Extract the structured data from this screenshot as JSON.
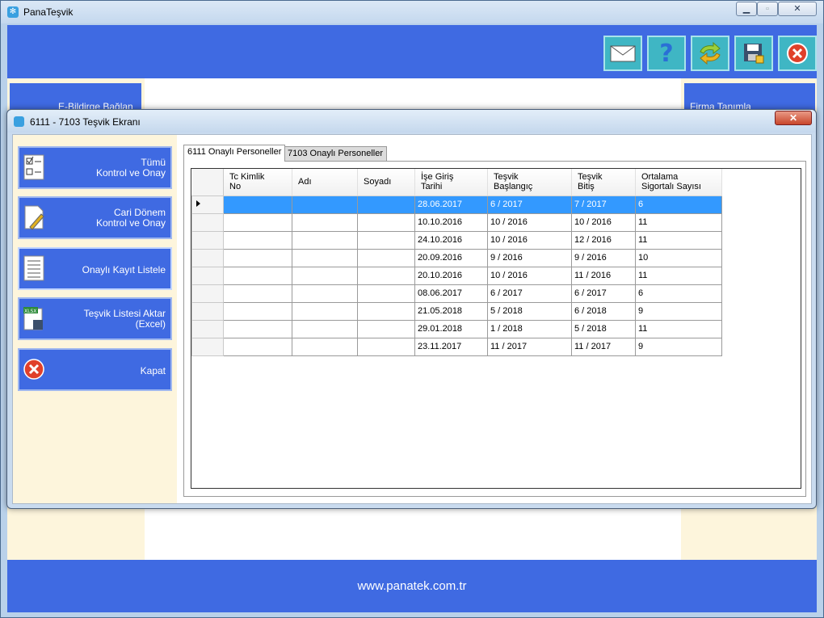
{
  "main_window": {
    "title": "PanaTeşvik",
    "min_label": "▭",
    "max_label": "□",
    "close_label": "✕"
  },
  "background": {
    "left_card_label": "E-Bildirge Bağlan",
    "right_card_label": "Firma Tanımla",
    "footer_url": "www.panatek.com.tr"
  },
  "dialog": {
    "title": "6111 - 7103 Teşvik Ekranı",
    "close_label": "✕",
    "side_buttons": [
      {
        "line1": "Tümü",
        "line2": "Kontrol ve Onay"
      },
      {
        "line1": "Cari Dönem",
        "line2": "Kontrol ve Onay"
      },
      {
        "line1": "Onaylı Kayıt Listele",
        "line2": ""
      },
      {
        "line1": "Teşvik Listesi Aktar",
        "line2": "(Excel)"
      },
      {
        "line1": "Kapat",
        "line2": ""
      }
    ],
    "tabs": [
      "6111 Onaylı Personeller",
      "7103 Onaylı Personeller"
    ],
    "columns": [
      {
        "l1": "Tc Kimlik",
        "l2": "No"
      },
      {
        "l1": "Adı",
        "l2": ""
      },
      {
        "l1": "Soyadı",
        "l2": ""
      },
      {
        "l1": "İşe Giriş",
        "l2": "Tarihi"
      },
      {
        "l1": "Teşvik",
        "l2": "Başlangıç"
      },
      {
        "l1": "Teşvik",
        "l2": "Bitiş"
      },
      {
        "l1": "Ortalama",
        "l2": "Sigortalı Sayısı"
      }
    ],
    "rows": [
      [
        "",
        "",
        "",
        "28.06.2017",
        "6 / 2017",
        "7 / 2017",
        "6"
      ],
      [
        "",
        "",
        "",
        "10.10.2016",
        "10 / 2016",
        "10 / 2016",
        "11"
      ],
      [
        "",
        "",
        "",
        "24.10.2016",
        "10 / 2016",
        "12 / 2016",
        "11"
      ],
      [
        "",
        "",
        "",
        "20.09.2016",
        "9 / 2016",
        "9 / 2016",
        "10"
      ],
      [
        "",
        "",
        "",
        "20.10.2016",
        "10 / 2016",
        "11 / 2016",
        "11"
      ],
      [
        "",
        "",
        "",
        "08.06.2017",
        "6 / 2017",
        "6 / 2017",
        "6"
      ],
      [
        "",
        "",
        "",
        "21.05.2018",
        "5 / 2018",
        "6 / 2018",
        "9"
      ],
      [
        "",
        "",
        "",
        "29.01.2018",
        "1 / 2018",
        "5 / 2018",
        "11"
      ],
      [
        "",
        "",
        "",
        "23.11.2017",
        "11 / 2017",
        "11 / 2017",
        "9"
      ]
    ]
  },
  "colors": {
    "primary_blue": "#3f6ae2",
    "cream": "#fdf5dc",
    "selection": "#3399ff",
    "toolbar_teal": "#3fb6c4"
  }
}
